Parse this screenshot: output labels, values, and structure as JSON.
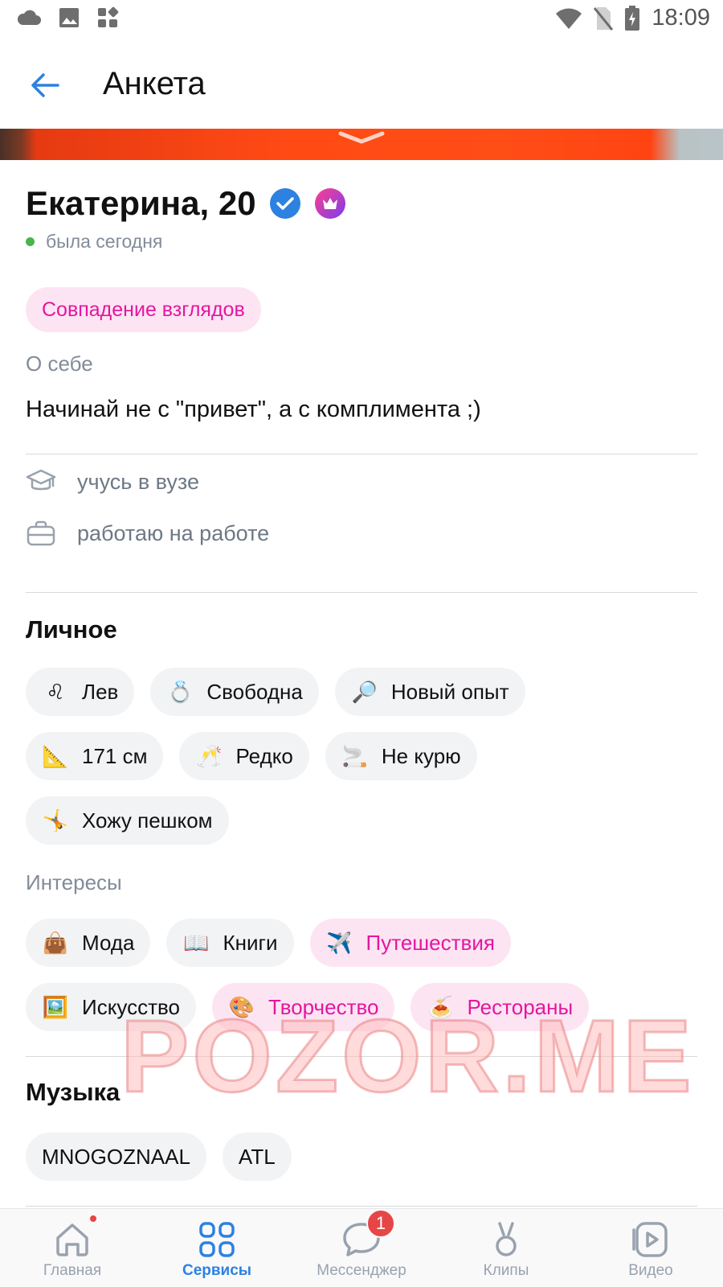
{
  "status_bar": {
    "time": "18:09",
    "icons": [
      "cloud-icon",
      "gallery-icon",
      "apps-icon",
      "wifi-icon",
      "no-sim-icon",
      "battery-charging-icon"
    ]
  },
  "header": {
    "title": "Анкета",
    "back_icon": "arrow-left-icon"
  },
  "profile": {
    "name_age": "Екатерина, 20",
    "verified_icon": "verified-check-icon",
    "premium_icon": "crown-icon",
    "last_seen": "была сегодня",
    "match_badge": "Совпадение взглядов",
    "about_label": "О себе",
    "about_text": "Начинай не с \"привет\", а с комплимента ;)",
    "education": "учусь в вузе",
    "work": "работаю на работе"
  },
  "personal": {
    "title": "Личное",
    "chips": [
      {
        "emoji": "♌",
        "label": "Лев"
      },
      {
        "emoji": "💍",
        "label": "Свободна"
      },
      {
        "emoji": "🔎",
        "label": "Новый опыт"
      },
      {
        "emoji": "📐",
        "label": "171 см"
      },
      {
        "emoji": "🥂",
        "label": "Редко"
      },
      {
        "emoji": "🚬",
        "label": "Не курю"
      },
      {
        "emoji": "🤸",
        "label": "Хожу пешком"
      }
    ]
  },
  "interests": {
    "title": "Интересы",
    "chips": [
      {
        "emoji": "👜",
        "label": "Мода",
        "match": false
      },
      {
        "emoji": "📖",
        "label": "Книги",
        "match": false
      },
      {
        "emoji": "✈️",
        "label": "Путешествия",
        "match": true
      },
      {
        "emoji": "🖼️",
        "label": "Искусство",
        "match": false
      },
      {
        "emoji": "🎨",
        "label": "Творчество",
        "match": true
      },
      {
        "emoji": "🍝",
        "label": "Рестораны",
        "match": true
      }
    ]
  },
  "music": {
    "title": "Музыка",
    "chips": [
      "MNOGOZNAAL",
      "ATL"
    ]
  },
  "watermark": "POZOR.ME",
  "tabbar": {
    "items": [
      {
        "label": "Главная",
        "icon": "home-icon"
      },
      {
        "label": "Сервисы",
        "icon": "services-grid-icon"
      },
      {
        "label": "Мессенджер",
        "icon": "chat-bubble-icon",
        "badge": "1"
      },
      {
        "label": "Клипы",
        "icon": "clips-icon"
      },
      {
        "label": "Видео",
        "icon": "video-play-icon"
      }
    ],
    "active": "Сервисы"
  },
  "colors": {
    "accent": "#2D81E0",
    "match_pink": "#E3179F",
    "match_bg": "#FDE4F3",
    "chip_bg": "#F2F3F5",
    "secondary_text": "#818C99",
    "online": "#4BB34B",
    "badge_red": "#E64646"
  }
}
